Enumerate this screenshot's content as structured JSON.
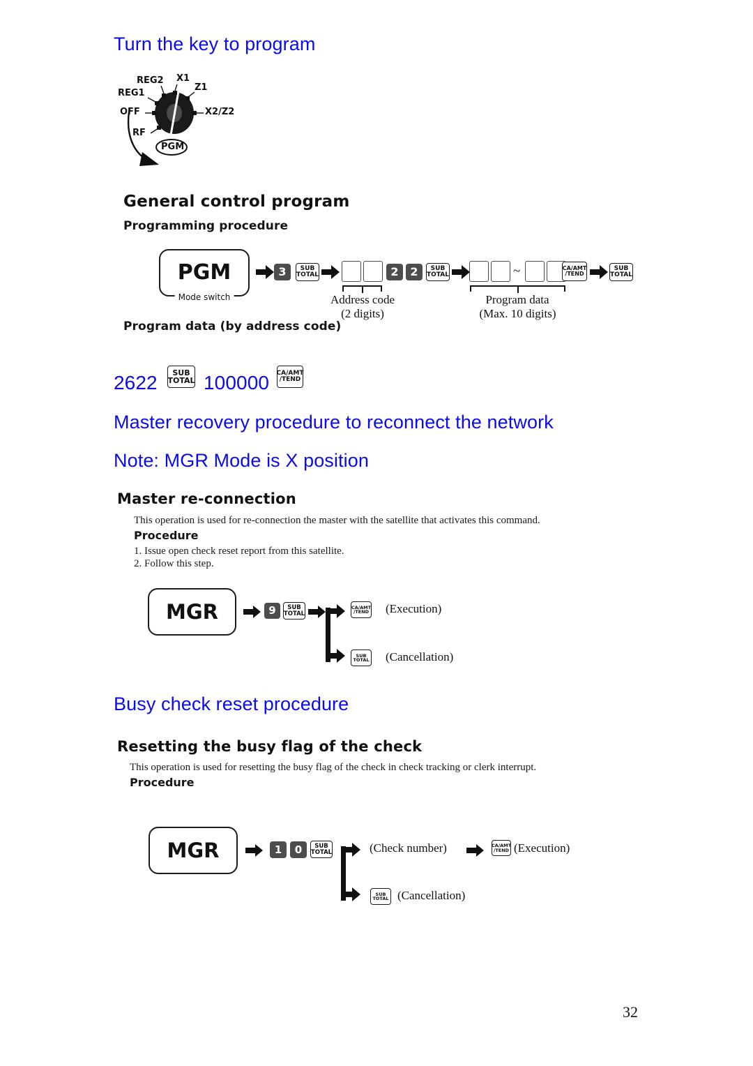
{
  "document": {
    "page_number": "32",
    "accent_color": "#0b0bf0"
  },
  "annotations": {
    "heading_turn_key": "Turn the key to program",
    "heading_master_recovery": "Master recovery procedure to reconnect the network",
    "note_mgr_mode": "Note: MGR Mode is X position",
    "heading_busy_check": "Busy check reset procedure",
    "example_address_code": "2622",
    "example_program_data": "100000"
  },
  "dial": {
    "labels": {
      "reg1": "REG1",
      "reg2": "REG2",
      "x1": "X1",
      "z1": "Z1",
      "off": "OFF",
      "x2z2": "X2/Z2",
      "rf": "RF",
      "pgm": "PGM"
    }
  },
  "general_control": {
    "title": "General control program",
    "subtitle": "Programming procedure",
    "section2_title": "Program data (by address code)",
    "mode_box": {
      "label": "PGM",
      "caption": "Mode switch"
    },
    "keys": {
      "three": "3",
      "two_a": "2",
      "two_b": "2",
      "subtotal_l1": "SUB",
      "subtotal_l2": "TOTAL",
      "caamt_l1": "CA/AMT",
      "caamt_l2": "/TEND"
    },
    "callouts": {
      "address_code_l1": "Address code",
      "address_code_l2": "(2 digits)",
      "program_data_l1": "Program data",
      "program_data_l2": "(Max. 10 digits)",
      "range_separator": "~"
    }
  },
  "master_reconnection": {
    "title": "Master re-connection",
    "description": "This operation is used for re-connection the master with the satellite that activates this command.",
    "procedure_title": "Procedure",
    "steps": [
      "1. Issue open check reset report from this satellite.",
      "2. Follow this step."
    ],
    "flow": {
      "mode_label": "MGR",
      "key_nine": "9",
      "subtotal_l1": "SUB",
      "subtotal_l2": "TOTAL",
      "caamt_l1": "CA/AMT",
      "caamt_l2": "/TEND",
      "execution_label": "(Execution)",
      "cancellation_label": "(Cancellation)"
    }
  },
  "busy_check_reset": {
    "title": "Resetting the busy flag of the check",
    "description": "This operation is used for resetting the busy flag of the check in check tracking or clerk interrupt.",
    "procedure_title": "Procedure",
    "flow": {
      "mode_label": "MGR",
      "key_one": "1",
      "key_zero": "0",
      "subtotal_l1": "SUB",
      "subtotal_l2": "TOTAL",
      "caamt_l1": "CA/AMT",
      "caamt_l2": "/TEND",
      "check_number_label": "(Check number)",
      "execution_label": "(Execution)",
      "cancellation_label": "(Cancellation)"
    }
  }
}
